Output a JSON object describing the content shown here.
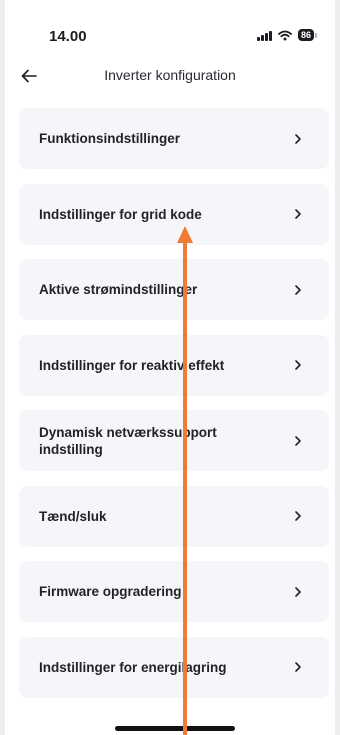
{
  "status_bar": {
    "time": "14.00",
    "signal_icon": "signal-icon",
    "wifi_icon": "wifi-icon",
    "battery_level": "86"
  },
  "header": {
    "back_icon": "arrow-left-icon",
    "title": "Inverter konfiguration"
  },
  "menu": {
    "chevron": ">",
    "items": [
      {
        "label": "Funktionsindstillinger"
      },
      {
        "label": "Indstillinger for grid kode"
      },
      {
        "label": "Aktive strømindstillinger"
      },
      {
        "label": "Indstillinger for reaktiv effekt"
      },
      {
        "label": "Dynamisk netværkssupport indstilling"
      },
      {
        "label": "Tænd/sluk"
      },
      {
        "label": "Firmware opgradering"
      },
      {
        "label": "Indstillinger for energilagring"
      }
    ]
  },
  "overlay": {
    "gesture": "swipe-up-arrow",
    "color": "#f07b34"
  }
}
